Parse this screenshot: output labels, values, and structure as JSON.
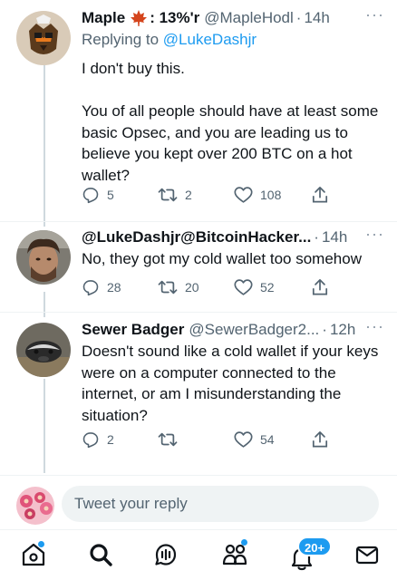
{
  "tweets": [
    {
      "name": "Maple",
      "name_suffix": ": 13%'r",
      "handle": "@MapleHodl",
      "time": "14h",
      "replying_prefix": "Replying to",
      "replying_to": "@LukeDashjr",
      "text": "I don't buy this.\n\nYou of all people should have at least some basic Opsec, and you are leading us to believe you kept over 200 BTC on a hot wallet?",
      "replies": "5",
      "retweets": "2",
      "likes": "108"
    },
    {
      "name": "@LukeDashjr@BitcoinHacker...",
      "handle": "",
      "time": "14h",
      "text": "No, they got my cold wallet too somehow",
      "replies": "28",
      "retweets": "20",
      "likes": "52"
    },
    {
      "name": "Sewer Badger",
      "handle": "@SewerBadger2...",
      "time": "12h",
      "text": "Doesn't sound like a cold wallet if your keys were on a computer connected to the internet, or am I misunderstanding the situation?",
      "replies": "2",
      "retweets": "",
      "likes": "54"
    }
  ],
  "reply_bar": {
    "placeholder": "Tweet your reply"
  },
  "nav": {
    "items": [
      "home-icon",
      "search-icon",
      "spaces-icon",
      "communities-icon",
      "notifications-icon",
      "messages-icon"
    ],
    "notification_badge": "20+"
  },
  "colors": {
    "accent": "#1d9bf0",
    "text": "#0f1419",
    "muted": "#536471",
    "line": "#cfd9de"
  },
  "dot_separator": "·",
  "more_glyph": "···"
}
